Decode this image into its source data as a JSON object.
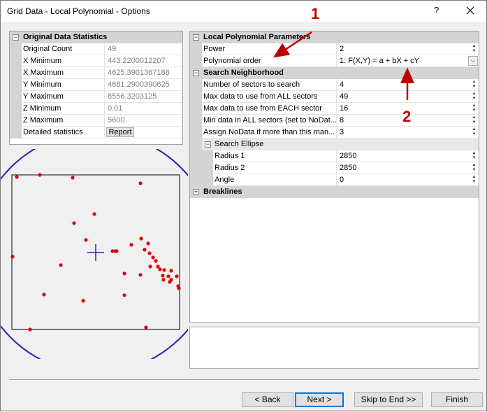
{
  "window": {
    "title": "Grid Data - Local Polynomial - Options",
    "help": "?"
  },
  "stats": {
    "header": "Original Data Statistics",
    "rows": [
      {
        "name": "Original Count",
        "value": "49"
      },
      {
        "name": "X Minimum",
        "value": "443.2200012207"
      },
      {
        "name": "X Maximum",
        "value": "4625.3901367188"
      },
      {
        "name": "Y Minimum",
        "value": "4681.2900390625"
      },
      {
        "name": "Y Maximum",
        "value": "8556.3203125"
      },
      {
        "name": "Z Minimum",
        "value": "0.01"
      },
      {
        "name": "Z Maximum",
        "value": "5600"
      }
    ],
    "detailed_label": "Detailed statistics",
    "report_button": "Report"
  },
  "params": {
    "local_header": "Local Polynomial Parameters",
    "power_label": "Power",
    "power_value": "2",
    "order_label": "Polynomial order",
    "order_value": "1:  F(X,Y) = a + bX + cY",
    "search_header": "Search Neighborhood",
    "search_rows": [
      {
        "name": "Number of sectors to search",
        "value": "4"
      },
      {
        "name": "Max data to use from ALL sectors",
        "value": "49"
      },
      {
        "name": "Max data to use from EACH sector",
        "value": "16"
      },
      {
        "name": "Min data in ALL sectors (set to NoDat...",
        "value": "8"
      },
      {
        "name": "Assign NoData if more than this man...",
        "value": "3"
      }
    ],
    "ellipse_header": "Search Ellipse",
    "ellipse_rows": [
      {
        "name": "Radius 1",
        "value": "2850"
      },
      {
        "name": "Radius 2",
        "value": "2850"
      },
      {
        "name": "Angle",
        "value": "0"
      }
    ],
    "breaklines_header": "Breaklines"
  },
  "annotations": {
    "arrow1": "1",
    "arrow2": "2",
    "color": "#c00000"
  },
  "buttons": {
    "back": "< Back",
    "next": "Next >",
    "skip": "Skip to End >>",
    "finish": "Finish"
  },
  "colors": {
    "point": "#e00000",
    "circle": "#2a1fb5",
    "center": "#2a1fb5"
  }
}
